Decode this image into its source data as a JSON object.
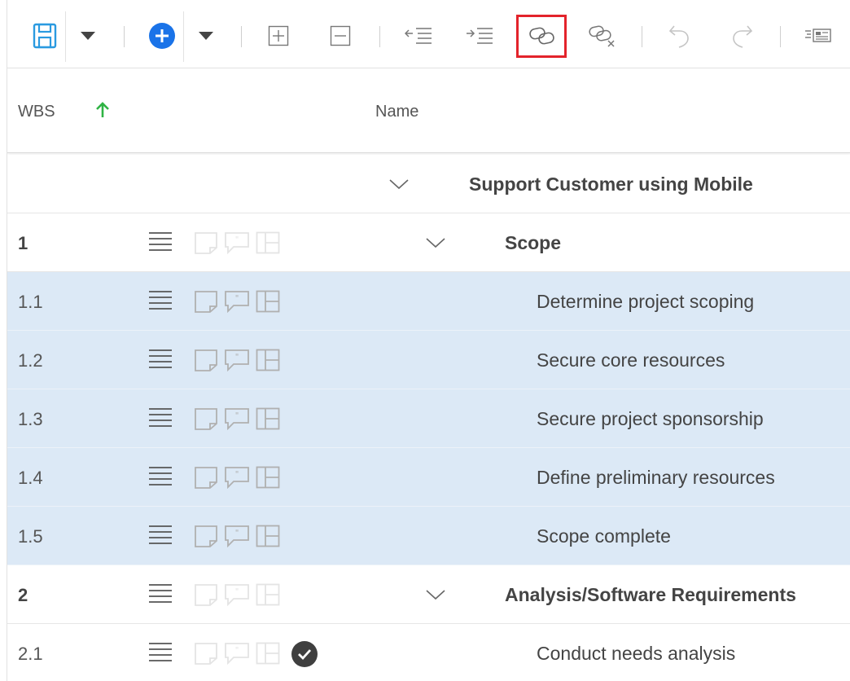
{
  "toolbar": {
    "buttons": [
      {
        "icon": "save-icon"
      },
      {
        "icon": "dropdown-arrow-icon"
      },
      {
        "icon": "add-task-icon"
      },
      {
        "icon": "dropdown-arrow-icon"
      },
      {
        "icon": "expand-all-icon"
      },
      {
        "icon": "collapse-all-icon"
      },
      {
        "icon": "outdent-icon"
      },
      {
        "icon": "indent-icon"
      },
      {
        "icon": "link-tasks-icon",
        "highlighted": true
      },
      {
        "icon": "unlink-tasks-icon"
      },
      {
        "icon": "undo-icon"
      },
      {
        "icon": "redo-icon"
      },
      {
        "icon": "details-pane-icon"
      }
    ],
    "highlight_color": "#e3232b",
    "accent": "#1a73e8"
  },
  "header": {
    "wbs_label": "WBS",
    "name_label": "Name",
    "sort_color": "#2fb344"
  },
  "rows": [
    {
      "wbs": "",
      "name": "Support Customer using Mobile",
      "type": "project",
      "selected": false
    },
    {
      "wbs": "1",
      "name": "Scope",
      "type": "summary",
      "selected": false
    },
    {
      "wbs": "1.1",
      "name": "Determine project scoping",
      "type": "task",
      "selected": true
    },
    {
      "wbs": "1.2",
      "name": "Secure core resources",
      "type": "task",
      "selected": true
    },
    {
      "wbs": "1.3",
      "name": "Secure project sponsorship",
      "type": "task",
      "selected": true
    },
    {
      "wbs": "1.4",
      "name": "Define preliminary resources",
      "type": "task",
      "selected": true
    },
    {
      "wbs": "1.5",
      "name": "Scope complete",
      "type": "task",
      "selected": true
    },
    {
      "wbs": "2",
      "name": "Analysis/Software Requirements",
      "type": "summary",
      "selected": false
    },
    {
      "wbs": "2.1",
      "name": "Conduct needs analysis",
      "type": "task",
      "selected": false,
      "completed": true
    }
  ],
  "colors": {
    "selected_row": "#dce9f6",
    "icon_gray": "#b5b5b5"
  }
}
